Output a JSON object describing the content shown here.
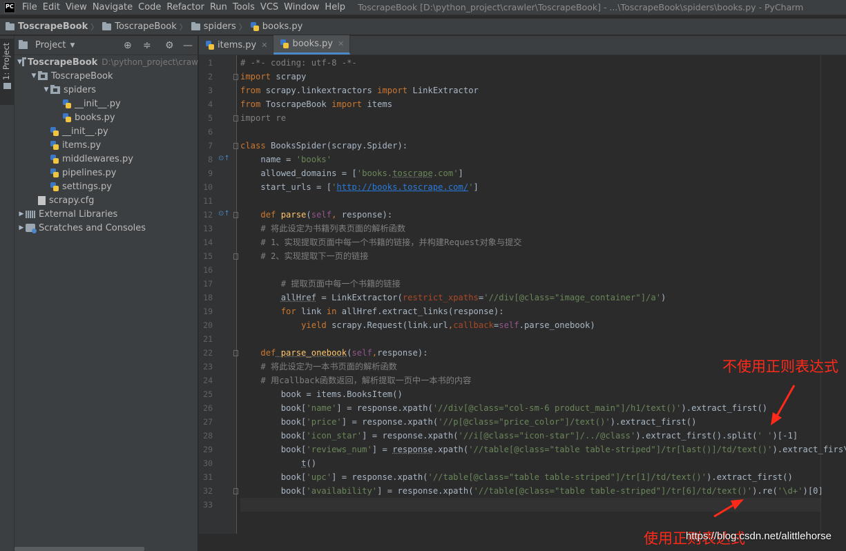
{
  "window": {
    "logo_text": "PC",
    "menu": [
      "File",
      "Edit",
      "View",
      "Navigate",
      "Code",
      "Refactor",
      "Run",
      "Tools",
      "VCS",
      "Window",
      "Help"
    ],
    "title": "ToscrapeBook [D:\\python_project\\crawler\\ToscrapeBook] - ...\\ToscrapeBook\\spiders\\books.py - PyCharm"
  },
  "breadcrumb": [
    "ToscrapeBook",
    "ToscrapeBook",
    "spiders",
    "books.py"
  ],
  "left_strip": {
    "tab_label": "1: Project"
  },
  "project_panel": {
    "title": "Project",
    "tree": [
      {
        "label": "ToscrapeBook",
        "hint": "D:\\python_project\\craw",
        "kind": "folder",
        "depth": 0,
        "expanded": true,
        "bold": true
      },
      {
        "label": "ToscrapeBook",
        "kind": "folder",
        "depth": 1,
        "expanded": true
      },
      {
        "label": "spiders",
        "kind": "folder",
        "depth": 2,
        "expanded": true
      },
      {
        "label": "__init__.py",
        "kind": "py",
        "depth": 3
      },
      {
        "label": "books.py",
        "kind": "py",
        "depth": 3
      },
      {
        "label": "__init__.py",
        "kind": "py",
        "depth": 2
      },
      {
        "label": "items.py",
        "kind": "py",
        "depth": 2
      },
      {
        "label": "middlewares.py",
        "kind": "py",
        "depth": 2
      },
      {
        "label": "pipelines.py",
        "kind": "py",
        "depth": 2
      },
      {
        "label": "settings.py",
        "kind": "py",
        "depth": 2
      },
      {
        "label": "scrapy.cfg",
        "kind": "file",
        "depth": 1
      },
      {
        "label": "External Libraries",
        "kind": "libs",
        "depth": 0,
        "expanded": false
      },
      {
        "label": "Scratches and Consoles",
        "kind": "scratch",
        "depth": 0,
        "expanded": false
      }
    ]
  },
  "tabs": [
    {
      "label": "items.py",
      "active": false
    },
    {
      "label": "books.py",
      "active": true
    }
  ],
  "editor": {
    "current_line": 33,
    "lines": [
      [
        [
          "cm",
          "# -*- coding: utf-8 -*-"
        ]
      ],
      [
        [
          "kw",
          "import"
        ],
        [
          "",
          " scrapy"
        ]
      ],
      [
        [
          "kw",
          "from"
        ],
        [
          "",
          " scrapy.linkextractors "
        ],
        [
          "kw",
          "import"
        ],
        [
          "",
          " LinkExtractor"
        ]
      ],
      [
        [
          "kw",
          "from"
        ],
        [
          "",
          " ToscrapeBook "
        ],
        [
          "kw",
          "import"
        ],
        [
          "",
          " items"
        ]
      ],
      [
        [
          "cm",
          "import re"
        ]
      ],
      [],
      [
        [
          "kw",
          "class"
        ],
        [
          "",
          " BooksSpider(scrapy.Spider):"
        ]
      ],
      [
        [
          "",
          "    name = "
        ],
        [
          "str",
          "'books'"
        ]
      ],
      [
        [
          "",
          "    allowed_domains = ["
        ],
        [
          "str",
          "'books."
        ],
        [
          "str-u",
          "toscrape"
        ],
        [
          "str",
          ".com'"
        ],
        [
          "",
          "]"
        ]
      ],
      [
        [
          "",
          "    start_urls = ["
        ],
        [
          "str",
          "'"
        ],
        [
          "link",
          "http://books.toscrape.com/"
        ],
        [
          "str",
          "'"
        ],
        [
          "",
          "]"
        ]
      ],
      [],
      [
        [
          "",
          "    "
        ],
        [
          "kw",
          "def"
        ],
        [
          "fn",
          " parse"
        ],
        [
          "",
          "("
        ],
        [
          "self",
          "self"
        ],
        [
          "kw",
          ","
        ],
        [
          "",
          " response):"
        ]
      ],
      [
        [
          "cm",
          "    # 将此设定为书籍列表页面的解析函数"
        ]
      ],
      [
        [
          "cm",
          "    # 1、实现提取页面中每一个书籍的链接，并构建Request对象与提交"
        ]
      ],
      [
        [
          "cm",
          "    # 2、实现提取下一页的链接"
        ]
      ],
      [],
      [
        [
          "cm",
          "        # 提取页面中每一个书籍的链接"
        ]
      ],
      [
        [
          "",
          "        "
        ],
        [
          "u",
          "allHref"
        ],
        [
          "",
          " = LinkExtractor("
        ],
        [
          "param",
          "restrict_xpaths"
        ],
        [
          "",
          "="
        ],
        [
          "str",
          "'//div[@class=\"image_container\"]/a'"
        ],
        [
          "",
          ")"
        ]
      ],
      [
        [
          "",
          "        "
        ],
        [
          "kw",
          "for"
        ],
        [
          "",
          " link "
        ],
        [
          "kw",
          "in"
        ],
        [
          "",
          " allHref.extract_links(response):"
        ]
      ],
      [
        [
          "",
          "            "
        ],
        [
          "kw",
          "yield"
        ],
        [
          "",
          " scrapy.Request(link.url"
        ],
        [
          "kw",
          ","
        ],
        [
          "param",
          "callback"
        ],
        [
          "",
          "="
        ],
        [
          "self",
          "self"
        ],
        [
          "",
          ".parse_onebook)"
        ]
      ],
      [],
      [
        [
          "",
          "    "
        ],
        [
          "kw",
          "def"
        ],
        [
          "fn-u",
          " parse_onebook"
        ],
        [
          "",
          "("
        ],
        [
          "self",
          "self"
        ],
        [
          "kw",
          ","
        ],
        [
          "",
          "response):"
        ]
      ],
      [
        [
          "cm",
          "    # 将此设定为一本书页面的解析函数"
        ]
      ],
      [
        [
          "cm",
          "    # 用callback函数返回，解析提取一页中一本书的内容"
        ]
      ],
      [
        [
          "",
          "        book = items.BooksItem()"
        ]
      ],
      [
        [
          "",
          "        book["
        ],
        [
          "str",
          "'name'"
        ],
        [
          "",
          "] = response.xpath("
        ],
        [
          "str",
          "'//div[@class=\"col-sm-6 product_main\"]/h1/text()'"
        ],
        [
          "",
          ").extract_first()"
        ]
      ],
      [
        [
          "",
          "        book["
        ],
        [
          "str",
          "'price'"
        ],
        [
          "",
          "] = response.xpath("
        ],
        [
          "str",
          "'//p[@class=\"price_color\"]/text()'"
        ],
        [
          "",
          ").extract_first()"
        ]
      ],
      [
        [
          "",
          "        book["
        ],
        [
          "str",
          "'icon_star'"
        ],
        [
          "",
          "] = response.xpath("
        ],
        [
          "str",
          "'//i[@class=\"icon-star\"]/../@class'"
        ],
        [
          "",
          ").extract_first().split("
        ],
        [
          "str",
          "' '"
        ],
        [
          "",
          ")[-1]"
        ]
      ],
      [
        [
          "",
          "        book["
        ],
        [
          "str",
          "'reviews_num'"
        ],
        [
          "",
          "] = "
        ],
        [
          "u",
          "response"
        ],
        [
          "",
          ".xpath("
        ],
        [
          "str",
          "'//table[@class=\"table table-striped\"]/tr[last()]/td/text()'"
        ],
        [
          "",
          ").extract_firs\\"
        ]
      ],
      [
        [
          "",
          "            "
        ],
        [
          "u",
          "t"
        ],
        [
          "",
          "()"
        ]
      ],
      [
        [
          "",
          "        book["
        ],
        [
          "str",
          "'upc'"
        ],
        [
          "",
          "] = response.xpath("
        ],
        [
          "str",
          "'//table[@class=\"table table-striped\"]/tr[1]/td/text()'"
        ],
        [
          "",
          ").extract_first()"
        ]
      ],
      [
        [
          "",
          "        book["
        ],
        [
          "str",
          "'availability'"
        ],
        [
          "",
          "] = response.xpath("
        ],
        [
          "str",
          "'//table[@class=\"table table-striped\"]/tr[6]/td/text()'"
        ],
        [
          "",
          ").re("
        ],
        [
          "str",
          "'\\d+'"
        ],
        [
          "",
          ")[0]"
        ]
      ],
      []
    ]
  },
  "annotations": {
    "top": "不使用正则表达式",
    "bottom": "使用正则表达式",
    "color": "#ff2a1a"
  },
  "watermark": "https://blog.csdn.net/alittlehorse"
}
